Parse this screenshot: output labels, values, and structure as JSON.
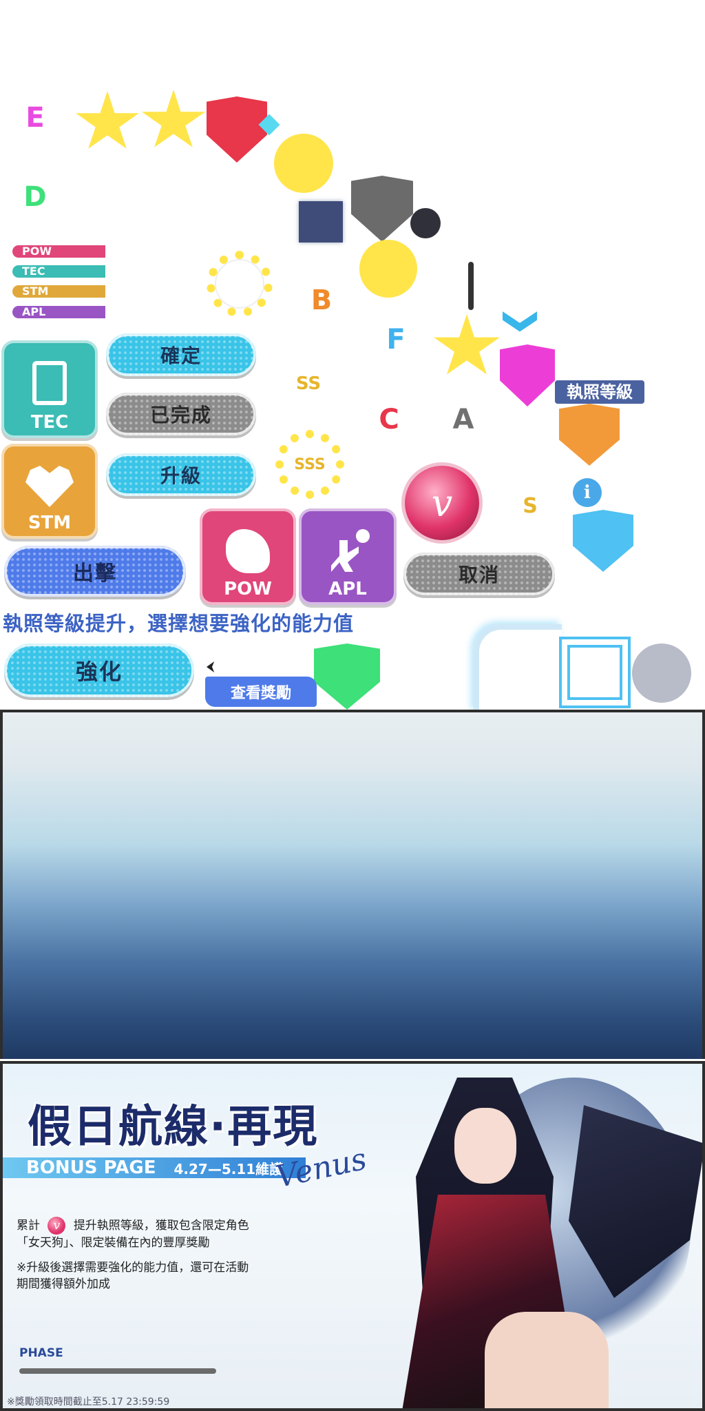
{
  "shield_letters": {
    "e": "E",
    "d": "D",
    "b": "B",
    "f": "F",
    "c": "C",
    "a": "A"
  },
  "star_letters": {
    "ss": "SS",
    "sss": "SSS",
    "s": "S"
  },
  "stat_bars": [
    {
      "label": "POW",
      "color": "#e0467a"
    },
    {
      "label": "TEC",
      "color": "#3bbcb4"
    },
    {
      "label": "STM",
      "color": "#e0a83a"
    },
    {
      "label": "APL",
      "color": "#9a55c4"
    }
  ],
  "stat_icons": {
    "tec": "TEC",
    "stm": "STM",
    "pow": "POW",
    "apl": "APL"
  },
  "buttons": {
    "confirm": "確定",
    "completed": "已完成",
    "upgrade": "升級",
    "sortie": "出擊",
    "cancel": "取消",
    "enhance": "強化",
    "view_reward": "查看獎勵"
  },
  "license_level_label": "執照等級",
  "upgrade_prompt": "執照等級提升，選擇想要強化的能力值",
  "banner": {
    "title": "假日航線·再現",
    "bonus_page": "BONUS PAGE",
    "date_range": "4.27—5.11維護",
    "script_name": "Venus",
    "desc1_pre": "累計",
    "desc1_post": "提升執照等級，獲取包含限定角色",
    "desc2": "「女天狗」、限定裝備在內的豐厚獎勵",
    "note1": "※升級後選擇需要強化的能力值，還可在活動",
    "note2": "期間獲得額外加成",
    "phase": "PHASE",
    "deadline": "※獎勵領取時間截止至5.17 23:59:59"
  },
  "colors": {
    "cyan": "#39c4e8",
    "gray": "#8c8c8c",
    "blue": "#4f7bea",
    "pink": "#e0467a",
    "purple": "#9a55c4",
    "teal": "#3bbcb4",
    "orange": "#e8a43a",
    "yellow": "#ffe54a"
  }
}
